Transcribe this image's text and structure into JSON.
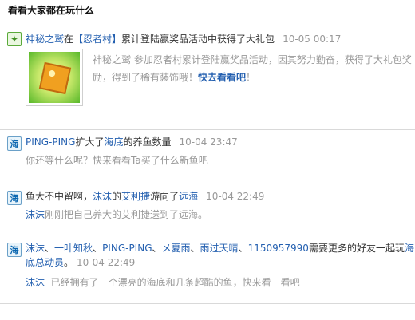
{
  "section_title": "看看大家都在玩什么",
  "items": [
    {
      "actor": "神秘之鹫",
      "text1": "在",
      "app_link": "【忍者村】",
      "text2": "累计登陆赢奖品活动中获得了大礼包",
      "time": "10-05 00:17",
      "desc_line1": "神秘之鹫 参加忍者村累计登陆赢奖品活动，因其努力勤奋，获得了大礼包奖",
      "desc_line2_text": "励，得到了稀有装饰哦！",
      "desc_link": "快去看看吧",
      "desc_tail": "！"
    },
    {
      "actor": "PING-PING",
      "text1": "扩大了",
      "app_link": "海底",
      "text2": "的养鱼数量",
      "time": "10-04 23:47",
      "detail": "你还等什么呢？快来看看Ta买了什么新鱼吧"
    },
    {
      "text_pre": "鱼大不中留啊，",
      "actor": "沫沫",
      "text1": "的",
      "fish_link": "艾利捷",
      "text2": "游向了",
      "sea_link": "远海",
      "time": "10-04 22:49",
      "detail_actor": "沫沫",
      "detail": "刚刚把自己养大的艾利捷送到了远海。"
    },
    {
      "friend1": "沫沫",
      "sep1": "、",
      "friend2": "一叶知秋",
      "sep2": "、",
      "friend3": "PING-PING",
      "sep3": "、",
      "friend4": "メ夏雨",
      "sep4": "、",
      "friend5": "雨过天晴",
      "sep5": "、",
      "friend6": "1150957990",
      "text1": "需要更多的好友一起玩",
      "app_link_part1": "海",
      "app_link_part2": "底总动员",
      "text2": "。",
      "time": "10-04 22:49",
      "detail_actor": "沫沫",
      "detail": "  已经拥有了一个漂亮的海底和几条超酷的鱼，快来看一看吧"
    }
  ],
  "icons": {
    "sea": "海",
    "ninja": "✦"
  }
}
